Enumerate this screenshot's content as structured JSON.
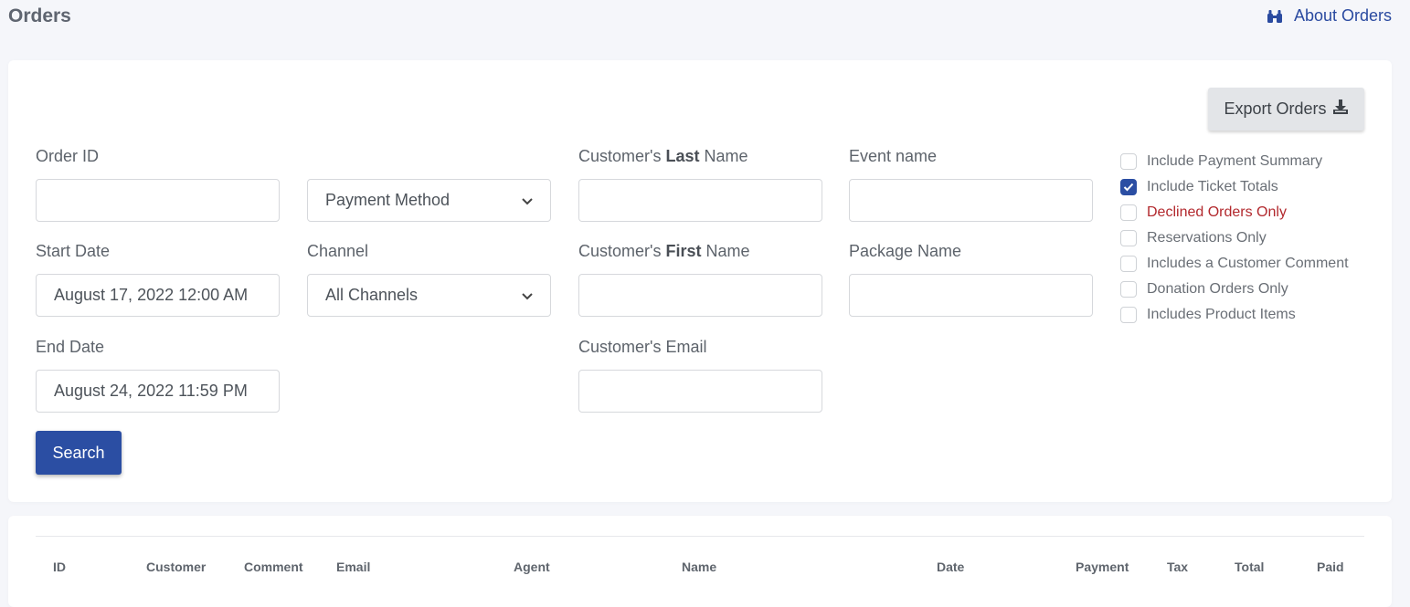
{
  "header": {
    "title": "Orders",
    "about_label": "About Orders",
    "about_icon": "binoculars-icon"
  },
  "toolbar": {
    "export_label": "Export Orders",
    "export_icon": "download-icon"
  },
  "filters": {
    "order_id": {
      "label": "Order ID",
      "value": "",
      "placeholder": ""
    },
    "payment_method": {
      "selected": "Payment Method"
    },
    "last_name": {
      "label_prefix": "Customer's ",
      "label_bold": "Last",
      "label_suffix": " Name",
      "value": ""
    },
    "event_name": {
      "label": "Event name",
      "value": ""
    },
    "start_date": {
      "label": "Start Date",
      "value": "August 17, 2022 12:00 AM"
    },
    "channel": {
      "label": "Channel",
      "selected": "All Channels"
    },
    "first_name": {
      "label_prefix": "Customer's ",
      "label_bold": "First",
      "label_suffix": " Name",
      "value": ""
    },
    "package_name": {
      "label": "Package Name",
      "value": ""
    },
    "end_date": {
      "label": "End Date",
      "value": "August 24, 2022 11:59 PM"
    },
    "email": {
      "label": "Customer's Email",
      "value": ""
    },
    "search_label": "Search"
  },
  "options": [
    {
      "label": "Include Payment Summary",
      "checked": false
    },
    {
      "label": "Include Ticket Totals",
      "checked": true
    },
    {
      "label": "Declined Orders Only",
      "checked": false
    },
    {
      "label": "Reservations Only",
      "checked": false
    },
    {
      "label": "Includes a Customer Comment",
      "checked": false
    },
    {
      "label": "Donation Orders Only",
      "checked": false
    },
    {
      "label": "Includes Product Items",
      "checked": false
    }
  ],
  "table": {
    "columns": [
      "ID",
      "Customer",
      "Comment",
      "Email",
      "Agent",
      "Name",
      "Date",
      "Payment",
      "Tax",
      "Total",
      "Paid"
    ]
  },
  "colors": {
    "primary": "#2b4ea3",
    "danger": "#b2282d"
  }
}
